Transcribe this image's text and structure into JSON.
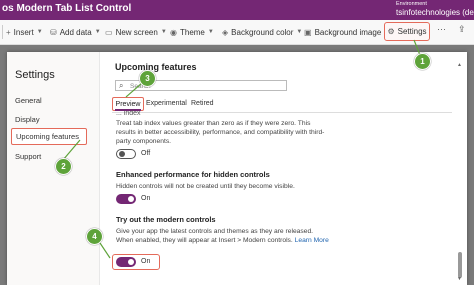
{
  "titlebar": {
    "app_title": "os Modern Tab List Control",
    "environment_label": "Environment",
    "environment_value": "tsinfotechnologies (de"
  },
  "commandbar": {
    "items": [
      {
        "label": "Insert",
        "icon": "plus-icon"
      },
      {
        "label": "Add data",
        "icon": "database-icon"
      },
      {
        "label": "New screen",
        "icon": "screen-icon"
      },
      {
        "label": "Theme",
        "icon": "palette-icon"
      },
      {
        "label": "Background color",
        "icon": "paint-bucket-icon"
      },
      {
        "label": "Background image",
        "icon": "image-icon"
      }
    ],
    "settings_label": "Settings",
    "more_label": "···"
  },
  "dialog": {
    "title": "Settings",
    "nav": {
      "general": "General",
      "display": "Display",
      "upcoming": "Upcoming features",
      "support": "Support"
    },
    "content": {
      "title": "Upcoming features",
      "search_placeholder": "Search",
      "tabs": {
        "preview": "Preview",
        "experimental": "Experimental",
        "retired": "Retired"
      },
      "partial_heading": "... index",
      "feature1": {
        "description": "Treat tab index values greater than zero as if they were zero. This results in better accessibility, performance, and compatibility with third-party components.",
        "toggle_label": "Off",
        "state": "off"
      },
      "feature2": {
        "heading": "Enhanced performance for hidden controls",
        "description": "Hidden controls will not be created until they become visible.",
        "toggle_label": "On",
        "state": "on"
      },
      "feature3": {
        "heading": "Try out the modern controls",
        "description": "Give your app the latest controls and themes as they are released. When enabled, they will appear at Insert > Modern controls.",
        "link": "Learn More",
        "toggle_label": "On",
        "state": "on"
      }
    }
  },
  "callouts": [
    "1",
    "2",
    "3",
    "4"
  ],
  "colors": {
    "brand": "#742774",
    "highlight": "#e46a5a",
    "callout": "#5ea33a"
  }
}
